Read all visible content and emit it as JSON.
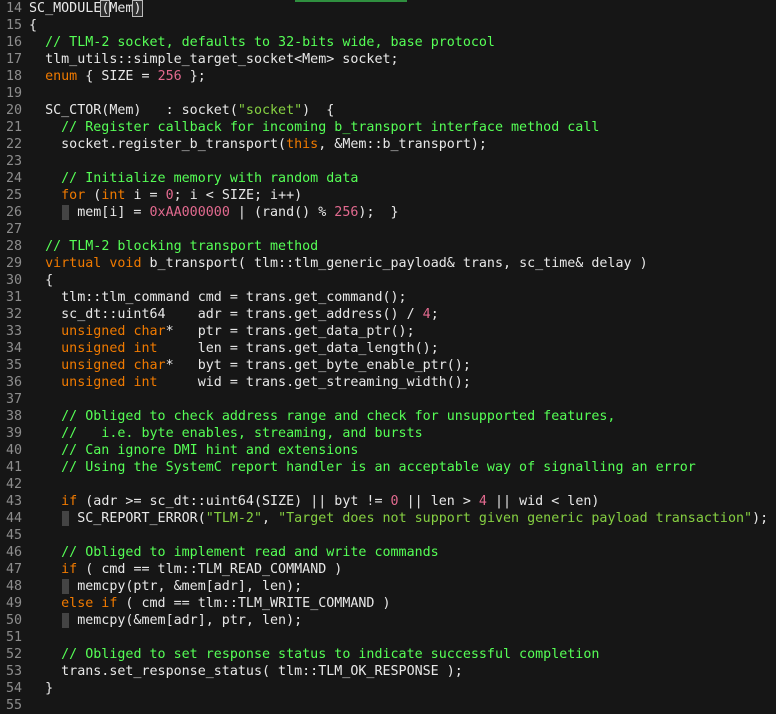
{
  "editor": {
    "lines": [
      {
        "n": "14",
        "tokens": [
          [
            "plain",
            "SC_MODULE"
          ],
          [
            "hl",
            "("
          ],
          [
            "plain",
            "Mem"
          ],
          [
            "hl",
            ")"
          ]
        ]
      },
      {
        "n": "15",
        "tokens": [
          [
            "plain",
            "{"
          ]
        ]
      },
      {
        "n": "16",
        "tokens": [
          [
            "plain",
            "  "
          ],
          [
            "com",
            "// TLM-2 socket, defaults to 32-bits wide, base protocol"
          ]
        ]
      },
      {
        "n": "17",
        "tokens": [
          [
            "plain",
            "  tlm_utils::simple_target_socket<Mem> socket;"
          ]
        ]
      },
      {
        "n": "18",
        "tokens": [
          [
            "plain",
            "  "
          ],
          [
            "kw",
            "enum"
          ],
          [
            "plain",
            " { SIZE = "
          ],
          [
            "num",
            "256"
          ],
          [
            "plain",
            " };"
          ]
        ]
      },
      {
        "n": "19",
        "tokens": []
      },
      {
        "n": "20",
        "tokens": [
          [
            "plain",
            "  SC_CTOR(Mem)   : socket("
          ],
          [
            "str",
            "\"socket\""
          ],
          [
            "plain",
            ")  {"
          ]
        ]
      },
      {
        "n": "21",
        "tokens": [
          [
            "plain",
            "    "
          ],
          [
            "com",
            "// Register callback for incoming b_transport interface method call"
          ]
        ]
      },
      {
        "n": "22",
        "tokens": [
          [
            "plain",
            "    socket.register_b_transport("
          ],
          [
            "kw",
            "this"
          ],
          [
            "plain",
            ", &Mem::b_transport);"
          ]
        ]
      },
      {
        "n": "23",
        "tokens": []
      },
      {
        "n": "24",
        "tokens": [
          [
            "plain",
            "    "
          ],
          [
            "com",
            "// Initialize memory with random data"
          ]
        ]
      },
      {
        "n": "25",
        "tokens": [
          [
            "plain",
            "    "
          ],
          [
            "kw",
            "for"
          ],
          [
            "plain",
            " ("
          ],
          [
            "kw",
            "int"
          ],
          [
            "plain",
            " i = "
          ],
          [
            "num",
            "0"
          ],
          [
            "plain",
            "; i < SIZE; i++)"
          ]
        ]
      },
      {
        "n": "26",
        "guide": true,
        "tokens": [
          [
            "plain",
            "      mem[i] = "
          ],
          [
            "num",
            "0xAA000000"
          ],
          [
            "plain",
            " | (rand() % "
          ],
          [
            "num",
            "256"
          ],
          [
            "plain",
            ");  }"
          ]
        ]
      },
      {
        "n": "27",
        "tokens": []
      },
      {
        "n": "28",
        "tokens": [
          [
            "plain",
            "  "
          ],
          [
            "com",
            "// TLM-2 blocking transport method"
          ]
        ]
      },
      {
        "n": "29",
        "tokens": [
          [
            "plain",
            "  "
          ],
          [
            "kw",
            "virtual void"
          ],
          [
            "plain",
            " b_transport( tlm::tlm_generic_payload& trans, sc_time& delay )"
          ]
        ]
      },
      {
        "n": "30",
        "tokens": [
          [
            "plain",
            "  {"
          ]
        ]
      },
      {
        "n": "31",
        "tokens": [
          [
            "plain",
            "    tlm::tlm_command cmd = trans.get_command();"
          ]
        ]
      },
      {
        "n": "32",
        "tokens": [
          [
            "plain",
            "    sc_dt::uint64    adr = trans.get_address() / "
          ],
          [
            "num",
            "4"
          ],
          [
            "plain",
            ";"
          ]
        ]
      },
      {
        "n": "33",
        "tokens": [
          [
            "plain",
            "    "
          ],
          [
            "kw",
            "unsigned char"
          ],
          [
            "plain",
            "*   ptr = trans.get_data_ptr();"
          ]
        ]
      },
      {
        "n": "34",
        "tokens": [
          [
            "plain",
            "    "
          ],
          [
            "kw",
            "unsigned int"
          ],
          [
            "plain",
            "     len = trans.get_data_length();"
          ]
        ]
      },
      {
        "n": "35",
        "tokens": [
          [
            "plain",
            "    "
          ],
          [
            "kw",
            "unsigned char"
          ],
          [
            "plain",
            "*   byt = trans.get_byte_enable_ptr();"
          ]
        ]
      },
      {
        "n": "36",
        "tokens": [
          [
            "plain",
            "    "
          ],
          [
            "kw",
            "unsigned int"
          ],
          [
            "plain",
            "     wid = trans.get_streaming_width();"
          ]
        ]
      },
      {
        "n": "37",
        "tokens": []
      },
      {
        "n": "38",
        "tokens": [
          [
            "plain",
            "    "
          ],
          [
            "com",
            "// Obliged to check address range and check for unsupported features,"
          ]
        ]
      },
      {
        "n": "39",
        "tokens": [
          [
            "plain",
            "    "
          ],
          [
            "com",
            "//   i.e. byte enables, streaming, and bursts"
          ]
        ]
      },
      {
        "n": "40",
        "tokens": [
          [
            "plain",
            "    "
          ],
          [
            "com",
            "// Can ignore DMI hint and extensions"
          ]
        ]
      },
      {
        "n": "41",
        "tokens": [
          [
            "plain",
            "    "
          ],
          [
            "com",
            "// Using the SystemC report handler is an acceptable way of signalling an error"
          ]
        ]
      },
      {
        "n": "42",
        "tokens": []
      },
      {
        "n": "43",
        "tokens": [
          [
            "plain",
            "    "
          ],
          [
            "kw",
            "if"
          ],
          [
            "plain",
            " (adr >= sc_dt::uint64(SIZE) || byt != "
          ],
          [
            "num",
            "0"
          ],
          [
            "plain",
            " || len > "
          ],
          [
            "num",
            "4"
          ],
          [
            "plain",
            " || wid < len)"
          ]
        ]
      },
      {
        "n": "44",
        "guide": true,
        "tokens": [
          [
            "plain",
            "      SC_REPORT_ERROR("
          ],
          [
            "str",
            "\"TLM-2\""
          ],
          [
            "plain",
            ", "
          ],
          [
            "str",
            "\"Target does not support given generic payload transaction\""
          ],
          [
            "plain",
            ");"
          ]
        ]
      },
      {
        "n": "45",
        "tokens": []
      },
      {
        "n": "46",
        "tokens": [
          [
            "plain",
            "    "
          ],
          [
            "com",
            "// Obliged to implement read and write commands"
          ]
        ]
      },
      {
        "n": "47",
        "tokens": [
          [
            "plain",
            "    "
          ],
          [
            "kw",
            "if"
          ],
          [
            "plain",
            " ( cmd == tlm::TLM_READ_COMMAND )"
          ]
        ]
      },
      {
        "n": "48",
        "guide": true,
        "tokens": [
          [
            "plain",
            "      memcpy(ptr, &mem[adr], len);"
          ]
        ]
      },
      {
        "n": "49",
        "tokens": [
          [
            "plain",
            "    "
          ],
          [
            "kw",
            "else if"
          ],
          [
            "plain",
            " ( cmd == tlm::TLM_WRITE_COMMAND )"
          ]
        ]
      },
      {
        "n": "50",
        "guide": true,
        "tokens": [
          [
            "plain",
            "      memcpy(&mem[adr], ptr, len);"
          ]
        ]
      },
      {
        "n": "51",
        "tokens": []
      },
      {
        "n": "52",
        "tokens": [
          [
            "plain",
            "    "
          ],
          [
            "com",
            "// Obliged to set response status to indicate successful completion"
          ]
        ]
      },
      {
        "n": "53",
        "tokens": [
          [
            "plain",
            "    trans.set_response_status( tlm::TLM_OK_RESPONSE );"
          ]
        ]
      },
      {
        "n": "54",
        "tokens": [
          [
            "plain",
            "  }"
          ]
        ]
      },
      {
        "n": "55",
        "tokens": []
      }
    ]
  }
}
